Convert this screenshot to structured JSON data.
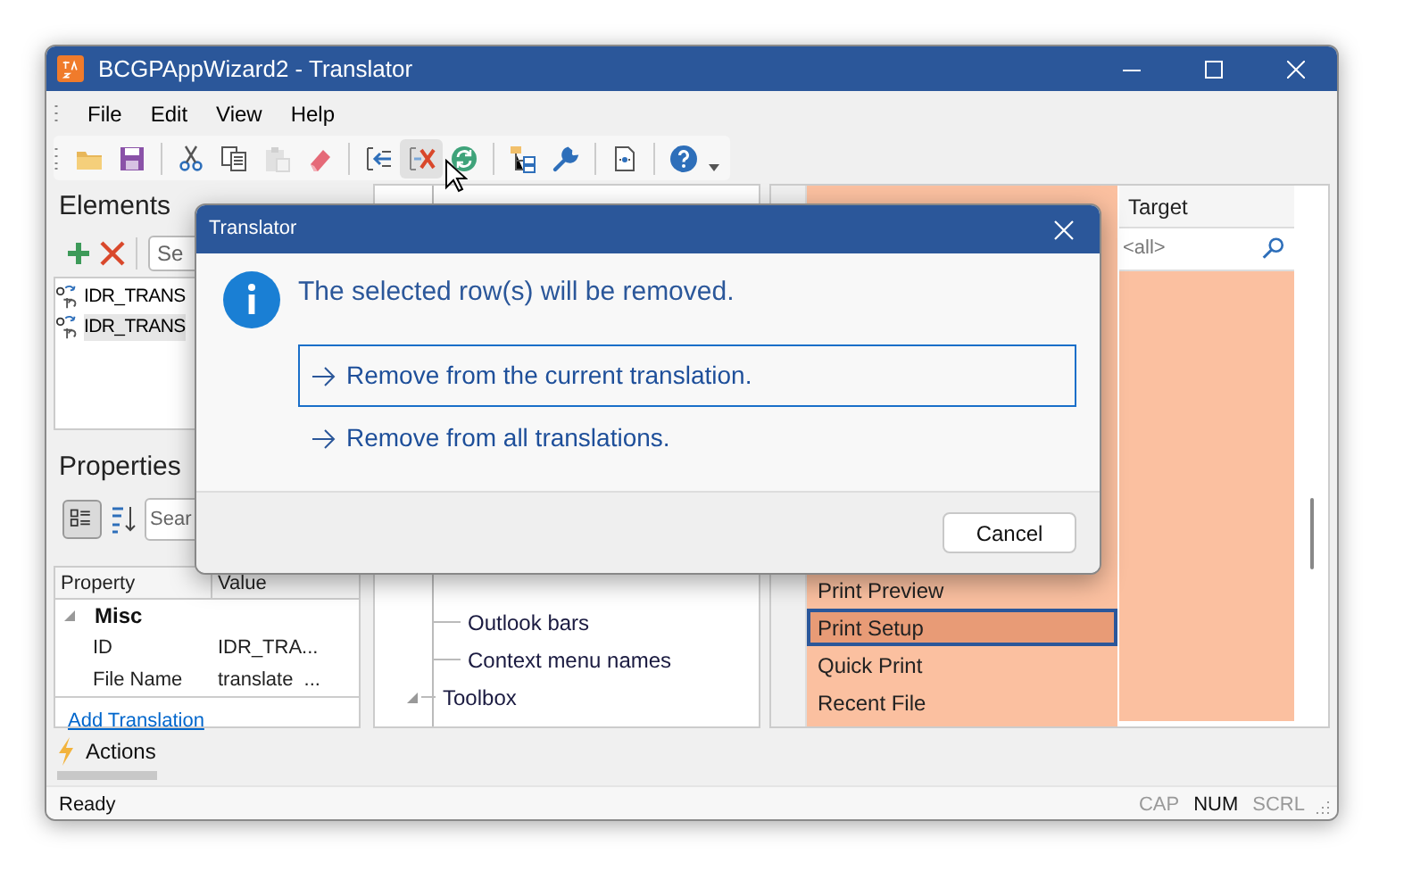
{
  "window": {
    "title": "BCGPAppWizard2 - Translator"
  },
  "menu": [
    "File",
    "Edit",
    "View",
    "Help"
  ],
  "toolbar_groups": [
    [
      {
        "kind": "open",
        "disabled": false,
        "hovered": false
      },
      {
        "kind": "save",
        "disabled": false,
        "hovered": false
      }
    ],
    [
      {
        "kind": "cut",
        "disabled": false,
        "hovered": false
      },
      {
        "kind": "copy",
        "disabled": false,
        "hovered": false
      },
      {
        "kind": "paste",
        "disabled": true,
        "hovered": false
      },
      {
        "kind": "eraser",
        "disabled": false,
        "hovered": false
      }
    ],
    [
      {
        "kind": "import",
        "disabled": false,
        "hovered": false
      },
      {
        "kind": "delete",
        "disabled": false,
        "hovered": true
      },
      {
        "kind": "refresh",
        "disabled": false,
        "hovered": false
      }
    ],
    [
      {
        "kind": "tree",
        "disabled": false,
        "hovered": false
      },
      {
        "kind": "wrench",
        "disabled": false,
        "hovered": false
      }
    ],
    [
      {
        "kind": "document",
        "disabled": false,
        "hovered": false
      }
    ],
    [
      {
        "kind": "help",
        "disabled": false,
        "hovered": false
      }
    ]
  ],
  "elements": {
    "title": "Elements",
    "search": {
      "placeholder": "Se"
    },
    "items": [
      {
        "text": "IDR_TRANS",
        "selected": false
      },
      {
        "text": "IDR_TRANS",
        "selected": true
      }
    ]
  },
  "properties": {
    "title": "Properties",
    "search": {
      "placeholder": "Sear"
    },
    "columns": [
      "Property",
      "Value"
    ],
    "category": {
      "label": "Misc",
      "expanded": true
    },
    "rows": [
      {
        "property": "ID",
        "value": "IDR_TRA..."
      },
      {
        "property": "File Name",
        "value": "translate  ..."
      }
    ],
    "link": "Add Translation"
  },
  "tree": {
    "items": [
      {
        "kind": "leaf",
        "label": "Outlook bars"
      },
      {
        "kind": "leaf",
        "label": "Context menu names"
      },
      {
        "kind": "group",
        "label": "Toolbox",
        "expanded": true
      }
    ]
  },
  "grid": {
    "target_header": "Target",
    "target_filter": "<all>",
    "rows": [
      {
        "source": "Print Preview",
        "selected": false
      },
      {
        "source": "Print Setup",
        "selected": true
      },
      {
        "source": "Quick Print",
        "selected": false
      },
      {
        "source": "Recent File",
        "selected": false
      }
    ]
  },
  "actions": {
    "label": "Actions"
  },
  "status_bar": {
    "text": "Ready",
    "indicators": [
      {
        "label": "CAP",
        "on": false
      },
      {
        "label": "NUM",
        "on": true
      },
      {
        "label": "SCRL",
        "on": false
      }
    ]
  },
  "dialog": {
    "title": "Translator",
    "message": "The selected row(s) will be removed.",
    "options": [
      {
        "label": "Remove from the current translation.",
        "selected": true
      },
      {
        "label": "Remove from all translations.",
        "selected": false
      }
    ],
    "buttons": [
      "Cancel"
    ]
  }
}
